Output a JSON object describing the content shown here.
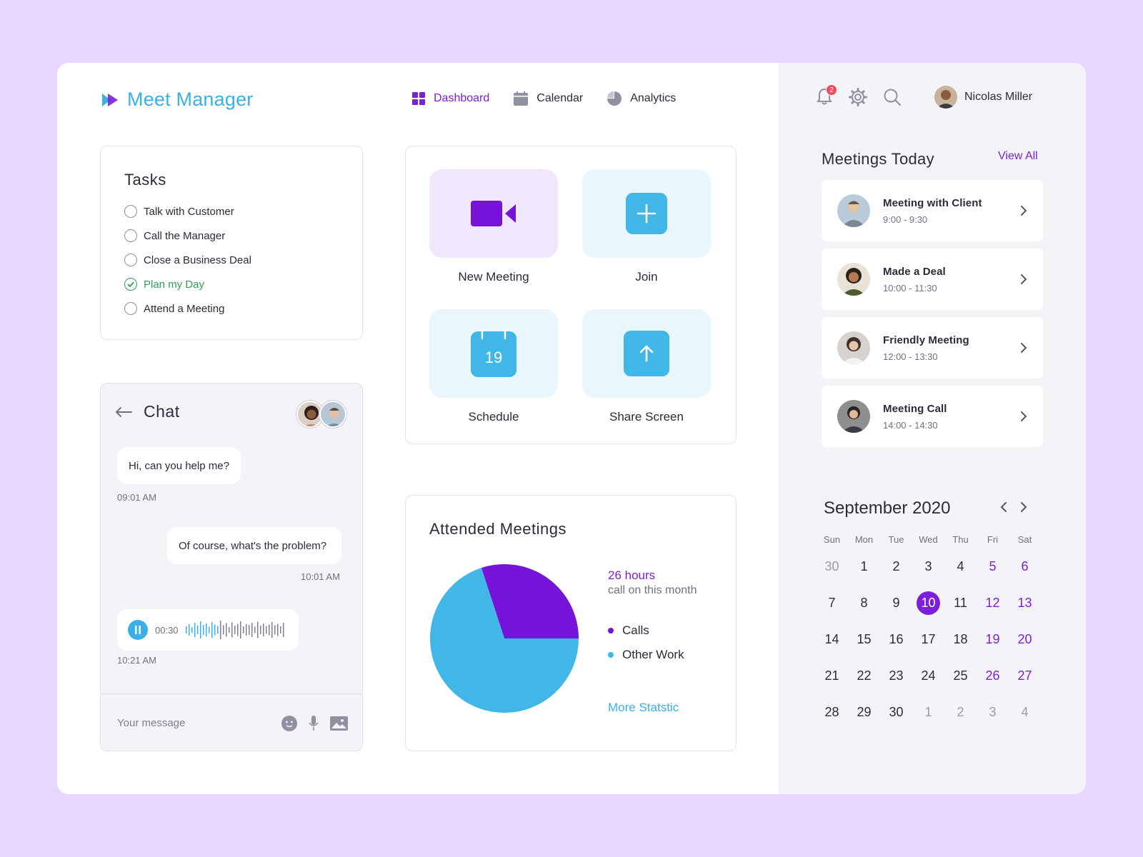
{
  "app": {
    "title": "Meet Manager"
  },
  "nav": [
    {
      "label": "Dashboard",
      "icon": "grid-icon",
      "active": true
    },
    {
      "label": "Calendar",
      "icon": "calendar-icon",
      "active": false
    },
    {
      "label": "Analytics",
      "icon": "pie-chart-icon",
      "active": false
    }
  ],
  "header": {
    "notifications_count": "2",
    "user_name": "Nicolas Miller"
  },
  "tasks": {
    "title": "Tasks",
    "items": [
      {
        "label": "Talk with Customer",
        "done": false
      },
      {
        "label": "Call the Manager",
        "done": false
      },
      {
        "label": "Close a Business Deal",
        "done": false
      },
      {
        "label": "Plan my Day",
        "done": true
      },
      {
        "label": "Attend a Meeting",
        "done": false
      }
    ]
  },
  "chat": {
    "title": "Chat",
    "messages": [
      {
        "text": "Hi, can you help me?",
        "time": "09:01 AM",
        "side": "left"
      },
      {
        "text": "Of course, what's the problem?",
        "time": "10:01 AM",
        "side": "right"
      }
    ],
    "voice": {
      "duration": "00:30",
      "time": "10:21 AM"
    },
    "input_placeholder": "Your message"
  },
  "actions": [
    {
      "label": "New Meeting",
      "icon": "video-camera-icon"
    },
    {
      "label": "Join",
      "icon": "plus-icon"
    },
    {
      "label": "Schedule",
      "icon": "calendar-date-icon",
      "icon_text": "19"
    },
    {
      "label": "Share Screen",
      "icon": "arrow-up-icon"
    }
  ],
  "attended": {
    "title": "Attended Meetings",
    "hours": "26 hours",
    "subtitle": "call on this month",
    "more_link": "More Statstic"
  },
  "chart_data": {
    "type": "pie",
    "labels": [
      "Calls",
      "Other Work"
    ],
    "values": [
      30,
      70
    ],
    "colors": [
      "#7613D8",
      "#41B7E8"
    ]
  },
  "meetings_today": {
    "title": "Meetings Today",
    "view_all": "View All",
    "items": [
      {
        "name": "Meeting with Client",
        "time": "9:00 - 9:30"
      },
      {
        "name": "Made a Deal",
        "time": "10:00 - 11:30"
      },
      {
        "name": "Friendly Meeting",
        "time": "12:00 - 13:30"
      },
      {
        "name": "Meeting Call",
        "time": "14:00 - 14:30"
      }
    ]
  },
  "calendar": {
    "title": "September 2020",
    "weekdays": [
      "Sun",
      "Mon",
      "Tue",
      "Wed",
      "Thu",
      "Fri",
      "Sat"
    ],
    "selected": "10",
    "weeks": [
      [
        "30",
        "1",
        "2",
        "3",
        "4",
        "5",
        "6"
      ],
      [
        "7",
        "8",
        "9",
        "10",
        "11",
        "12",
        "13"
      ],
      [
        "14",
        "15",
        "16",
        "17",
        "18",
        "19",
        "20"
      ],
      [
        "21",
        "22",
        "23",
        "24",
        "25",
        "26",
        "27"
      ],
      [
        "28",
        "29",
        "30",
        "1",
        "2",
        "3",
        "4"
      ]
    ]
  },
  "colors": {
    "accent": "#7B1FD8",
    "secondary": "#39B0E8",
    "background": "#E8D6FE",
    "success": "#2E9F5B"
  }
}
